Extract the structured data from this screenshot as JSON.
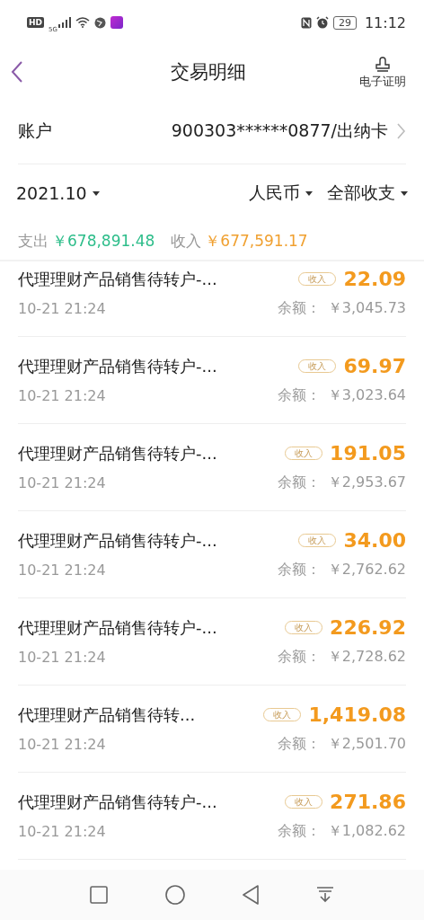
{
  "status_bar": {
    "left": [
      "HD",
      "5G"
    ],
    "battery": "29",
    "time": "11:12"
  },
  "header": {
    "title": "交易明细",
    "action": "电子证明"
  },
  "account": {
    "label": "账户",
    "value": "900303******0877/出纳卡"
  },
  "filters": {
    "month": "2021.10",
    "currency": "人民币",
    "scope": "全部收支"
  },
  "summary": {
    "expense_label": "支出",
    "expense": "￥678,891.48",
    "income_label": "收入",
    "income": "￥677,591.17"
  },
  "transactions": [
    {
      "title": "代理理财产品销售待转户-...",
      "time": "10-21 21:24",
      "kind": "income",
      "tag": "收入",
      "amount": "22.09",
      "balance_label": "余额：",
      "balance": "￥3,045.73"
    },
    {
      "title": "代理理财产品销售待转户-...",
      "time": "10-21 21:24",
      "kind": "income",
      "tag": "收入",
      "amount": "69.97",
      "balance_label": "余额：",
      "balance": "￥3,023.64"
    },
    {
      "title": "代理理财产品销售待转户-...",
      "time": "10-21 21:24",
      "kind": "income",
      "tag": "收入",
      "amount": "191.05",
      "balance_label": "余额：",
      "balance": "￥2,953.67"
    },
    {
      "title": "代理理财产品销售待转户-...",
      "time": "10-21 21:24",
      "kind": "income",
      "tag": "收入",
      "amount": "34.00",
      "balance_label": "余额：",
      "balance": "￥2,762.62"
    },
    {
      "title": "代理理财产品销售待转户-...",
      "time": "10-21 21:24",
      "kind": "income",
      "tag": "收入",
      "amount": "226.92",
      "balance_label": "余额：",
      "balance": "￥2,728.62"
    },
    {
      "title": "代理理财产品销售待转...",
      "time": "10-21 21:24",
      "kind": "income",
      "tag": "收入",
      "amount": "1,419.08",
      "balance_label": "余额：",
      "balance": "￥2,501.70"
    },
    {
      "title": "代理理财产品销售待转户-...",
      "time": "10-21 21:24",
      "kind": "income",
      "tag": "收入",
      "amount": "271.86",
      "balance_label": "余额：",
      "balance": "￥1,082.62"
    }
  ]
}
